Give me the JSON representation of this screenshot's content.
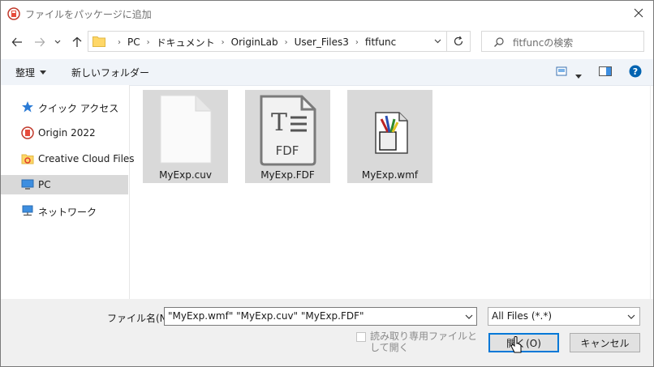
{
  "titlebar": {
    "title": "ファイルをパッケージに追加"
  },
  "address": {
    "crumbs": [
      "PC",
      "ドキュメント",
      "OriginLab",
      "User_Files3",
      "fitfunc"
    ]
  },
  "search": {
    "placeholder": "fitfuncの検索"
  },
  "toolbar": {
    "organize_label": "整理",
    "new_folder_label": "新しいフォルダー"
  },
  "sidebar": {
    "items": [
      {
        "label": "クイック アクセス",
        "icon": "star-icon"
      },
      {
        "label": "Origin 2022",
        "icon": "origin-icon"
      },
      {
        "label": "Creative Cloud Files",
        "icon": "creative-cloud-folder-icon"
      },
      {
        "label": "PC",
        "icon": "pc-icon",
        "selected": true
      },
      {
        "label": "ネットワーク",
        "icon": "network-icon"
      }
    ]
  },
  "files": [
    {
      "name": "MyExp.cuv",
      "icon": "blank-file-icon"
    },
    {
      "name": "MyExp.FDF",
      "icon": "fdf-file-icon"
    },
    {
      "name": "MyExp.wmf",
      "icon": "wmf-image-icon"
    }
  ],
  "bottom": {
    "filename_label": "ファイル名(N):",
    "filename_value": "\"MyExp.wmf\" \"MyExp.cuv\" \"MyExp.FDF\"",
    "filter_value": "All Files (*.*)",
    "readonly_label": "読み取り専用ファイルとして開く",
    "open_label": "開く(O)",
    "cancel_label": "キャンセル"
  },
  "colors": {
    "selection": "#d9d9d9",
    "accent": "#0078d7",
    "help": "#0063b1"
  }
}
